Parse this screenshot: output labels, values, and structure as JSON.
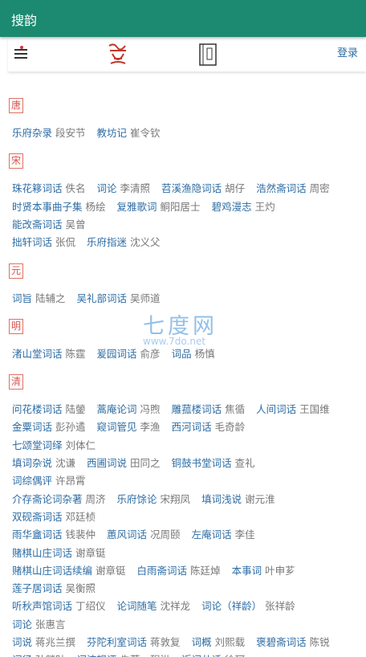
{
  "app_title": "搜韵",
  "toolbar": {
    "login": "登录"
  },
  "sections": [
    {
      "dynasty": "唐",
      "lines": [
        [
          {
            "t": "乐府杂录",
            "a": "段安节"
          },
          {
            "t": "教坊记",
            "a": "崔令钦"
          }
        ]
      ]
    },
    {
      "dynasty": "宋",
      "lines": [
        [
          {
            "t": "珠花簃词话",
            "a": "佚名"
          },
          {
            "t": "词论",
            "a": "李清照"
          },
          {
            "t": "苕溪渔隐词话",
            "a": "胡仔"
          },
          {
            "t": "浩然斋词话",
            "a": "周密"
          }
        ],
        [
          {
            "t": "时贤本事曲子集",
            "a": "杨绘"
          },
          {
            "t": "复雅歌词",
            "a": "鲖阳居士"
          },
          {
            "t": "碧鸡漫志",
            "a": "王灼"
          }
        ],
        [
          {
            "t": "能改斋词话",
            "a": "吴曾"
          }
        ],
        [
          {
            "t": "拙轩词话",
            "a": "张侃"
          },
          {
            "t": "乐府指迷",
            "a": "沈义父"
          }
        ]
      ]
    },
    {
      "dynasty": "元",
      "lines": [
        [
          {
            "t": "词旨",
            "a": "陆辅之"
          },
          {
            "t": "吴礼部词话",
            "a": "吴师道"
          }
        ]
      ]
    },
    {
      "dynasty": "明",
      "lines": [
        [
          {
            "t": "渚山堂词话",
            "a": "陈霆"
          },
          {
            "t": "爰园词话",
            "a": "俞彦"
          },
          {
            "t": "词品",
            "a": "杨慎"
          }
        ]
      ]
    },
    {
      "dynasty": "清",
      "lines": [
        [
          {
            "t": "问花楼词话",
            "a": "陆鎣"
          },
          {
            "t": "蒿庵论词",
            "a": "冯煦"
          },
          {
            "t": "雕菰楼词话",
            "a": "焦循"
          },
          {
            "t": "人间词话",
            "a": "王国维"
          }
        ],
        [
          {
            "t": "金粟词话",
            "a": "彭孙遹"
          },
          {
            "t": "窥词管见",
            "a": "李渔"
          },
          {
            "t": "西河词话",
            "a": "毛奇龄"
          }
        ],
        [
          {
            "t": "七颂堂词绎",
            "a": "刘体仁"
          }
        ],
        [
          {
            "t": "填词杂说",
            "a": "沈谦"
          },
          {
            "t": "西圃词说",
            "a": "田同之"
          },
          {
            "t": "铜鼓书堂词话",
            "a": "查礼"
          }
        ],
        [
          {
            "t": "词综偶评",
            "a": "许昂霄"
          }
        ],
        [
          {
            "t": "介存斋论词杂著",
            "a": "周济"
          },
          {
            "t": "乐府馀论",
            "a": "宋翔凤"
          },
          {
            "t": "填词浅说",
            "a": "谢元淮"
          }
        ],
        [
          {
            "t": "双砚斋词话",
            "a": "邓廷桢"
          }
        ],
        [
          {
            "t": "雨华盦词话",
            "a": "钱裴仲"
          },
          {
            "t": "蕙风词话",
            "a": "况周颐"
          },
          {
            "t": "左庵词话",
            "a": "李佳"
          }
        ],
        [
          {
            "t": "赌棋山庄词话",
            "a": "谢章铤"
          }
        ],
        [
          {
            "t": "赌棋山庄词话续编",
            "a": "谢章铤"
          },
          {
            "t": "白雨斋词话",
            "a": "陈廷焯"
          },
          {
            "t": "本事词",
            "a": "叶申芗"
          }
        ],
        [
          {
            "t": "莲子居词话",
            "a": "吴衡照"
          }
        ],
        [
          {
            "t": "听秋声馆词话",
            "a": "丁绍仪"
          },
          {
            "t": "论词随笔",
            "a": "沈祥龙"
          },
          {
            "t": "词论（祥龄）",
            "a": "张祥龄"
          }
        ],
        [
          {
            "t": "词论",
            "a": "张惠言"
          }
        ],
        [
          {
            "t": "词说",
            "a": "蒋兆兰撰"
          },
          {
            "t": "芬陀利室词话",
            "a": "蒋敦复"
          },
          {
            "t": "词概",
            "a": "刘熙载"
          },
          {
            "t": "褒碧斋词话",
            "a": "陈锐"
          }
        ],
        [
          {
            "t": "词径",
            "a": "孙麟趾"
          },
          {
            "t": "词洁辑评",
            "a": "先著、程洪"
          },
          {
            "t": "近词丛话",
            "a": "徐珂"
          }
        ]
      ]
    }
  ],
  "watermark": {
    "title": "七度网",
    "url": "www.7do.net"
  },
  "colors": {
    "header": "#1b8a70",
    "link": "#2e6da4",
    "dynasty": "#d9534f"
  }
}
